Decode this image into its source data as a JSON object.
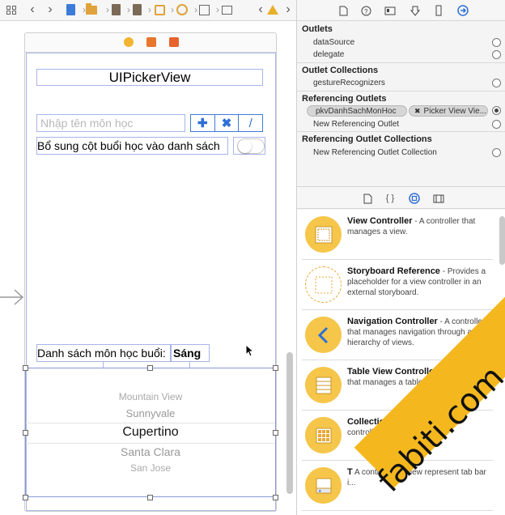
{
  "outlets_panel": {
    "outlets_title": "Outlets",
    "outlets": [
      "dataSource",
      "delegate"
    ],
    "outlet_collections_title": "Outlet Collections",
    "outlet_collections": [
      "gestureRecognizers"
    ],
    "referencing_outlets_title": "Referencing Outlets",
    "referencing_pill_left": "pkvDanhSachMonHoc",
    "referencing_pill_right": "Picker View Vie...",
    "new_referencing_outlet": "New Referencing Outlet",
    "referencing_collections_title": "Referencing Outlet Collections",
    "new_referencing_collection": "New Referencing Outlet Collection"
  },
  "library": {
    "items": [
      {
        "name": "View Controller",
        "desc": " - A controller that manages a view."
      },
      {
        "name": "Storyboard Reference",
        "desc": " - Provides a placeholder for a view controller in an external storyboard."
      },
      {
        "name": "Navigation Controller",
        "desc": " - A controller that manages navigation through a hierarchy of views."
      },
      {
        "name": "Table View Controller",
        "desc": " - A controller that manages a table view."
      },
      {
        "name": "Collection Vi",
        "desc": "controller collection"
      },
      {
        "name": "T",
        "desc": "A controller of view represent tab bar i..."
      }
    ]
  },
  "canvas": {
    "title_label": "UIPickerView",
    "name_placeholder": "Nhập tên môn học",
    "btn_add": "✚",
    "btn_delete": "✖",
    "btn_edit": "/",
    "supplement_label": "Bổ sung cột buổi học vào danh sách",
    "session_label": "Danh sách môn học buổi:",
    "session_value": "Sáng",
    "picker_rows": [
      "Mountain View",
      "Sunnyvale",
      "Cupertino",
      "Santa Clara",
      "San Jose"
    ]
  },
  "watermark": "fabiti.com",
  "colors": {
    "accent": "#3d7bd9",
    "selection": "#a9b4e8",
    "warning": "#e8b02a",
    "library_icon": "#f5c64a"
  }
}
